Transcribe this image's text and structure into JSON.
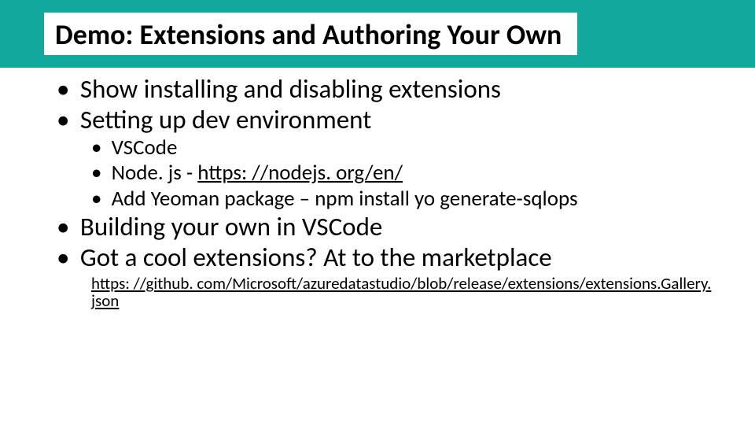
{
  "slide": {
    "title": "Demo: Extensions and Authoring Your Own",
    "bullets": {
      "b1": "Show installing and disabling extensions",
      "b2": "Setting up dev environment",
      "b2a": "VSCode",
      "b2b_prefix": "Node. js - ",
      "b2b_link": "https: //nodejs. org/en/",
      "b2c_prefix": "Add Yeoman package – ",
      "b2c_code": "npm install yo generate-sqlops",
      "b3": "Building your own in VSCode",
      "b4": "Got a cool extensions?  At to the marketplace",
      "b4_link": "https: //github. com/Microsoft/azuredatastudio/blob/release/extensions/extensions.Gallery. json"
    }
  }
}
